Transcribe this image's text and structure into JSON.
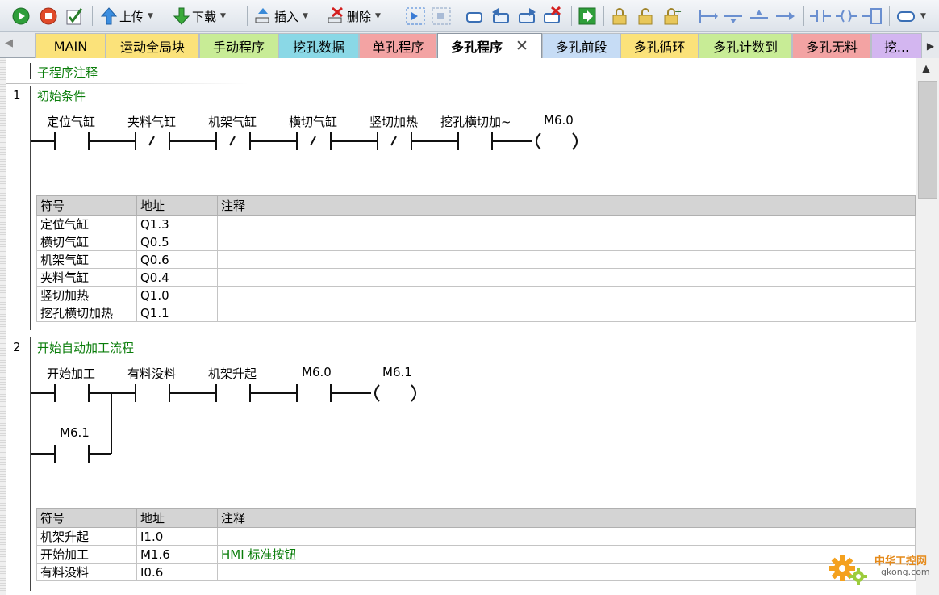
{
  "toolbar": {
    "upload": "上传",
    "download": "下载",
    "insert": "插入",
    "delete": "删除"
  },
  "tabs": [
    {
      "label": "MAIN",
      "color": "#fbe27a"
    },
    {
      "label": "运动全局块",
      "color": "#fbe27a"
    },
    {
      "label": "手动程序",
      "color": "#c8ec96"
    },
    {
      "label": "挖孔数据",
      "color": "#8ad8e6"
    },
    {
      "label": "单孔程序",
      "color": "#f3a3a3"
    },
    {
      "label": "多孔程序",
      "color": "#ffffff"
    },
    {
      "label": "多孔前段",
      "color": "#c6dcf5"
    },
    {
      "label": "多孔循环",
      "color": "#fbe27a"
    },
    {
      "label": "多孔计数到",
      "color": "#c8ec96"
    },
    {
      "label": "多孔无料",
      "color": "#f3a3a3"
    },
    {
      "label": "挖...",
      "color": "#d3b6f0"
    }
  ],
  "subroutine_comment": "子程序注释",
  "networks": [
    {
      "number": "1",
      "title": "初始条件",
      "contacts": [
        "定位气缸",
        "夹料气缸",
        "机架气缸",
        "横切气缸",
        "竖切加热",
        "挖孔横切加~"
      ],
      "contact_types": [
        "NO",
        "NC",
        "NC",
        "NC",
        "NC",
        "NO"
      ],
      "coil": "M6.0",
      "table": {
        "headers": [
          "符号",
          "地址",
          "注释"
        ],
        "rows": [
          [
            "定位气缸",
            "Q1.3",
            ""
          ],
          [
            "横切气缸",
            "Q0.5",
            ""
          ],
          [
            "机架气缸",
            "Q0.6",
            ""
          ],
          [
            "夹料气缸",
            "Q0.4",
            ""
          ],
          [
            "竖切加热",
            "Q1.0",
            ""
          ],
          [
            "挖孔横切加热",
            "Q1.1",
            ""
          ]
        ]
      }
    },
    {
      "number": "2",
      "title": "开始自动加工流程",
      "contacts": [
        "开始加工",
        "有料没料",
        "机架升起",
        "M6.0"
      ],
      "contact_types": [
        "NO",
        "NO",
        "NO",
        "NO"
      ],
      "branch_contact": "M6.1",
      "coil": "M6.1",
      "table": {
        "headers": [
          "符号",
          "地址",
          "注释"
        ],
        "rows": [
          [
            "机架升起",
            "I1.0",
            ""
          ],
          [
            "开始加工",
            "M1.6",
            "HMI 标准按钮"
          ],
          [
            "有料没料",
            "I0.6",
            ""
          ]
        ]
      }
    }
  ],
  "watermark": {
    "brand": "中华工控网",
    "url": "gkong.com"
  }
}
